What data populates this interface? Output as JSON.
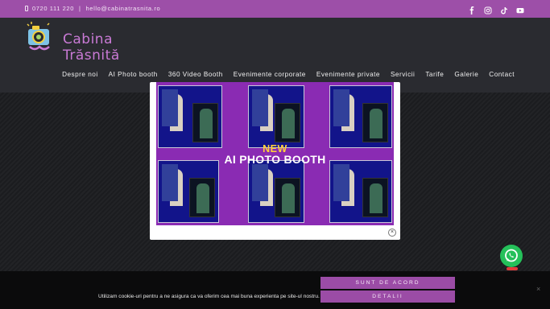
{
  "topbar": {
    "phone": "0720 111 220",
    "separator": "|",
    "email": "hello@cabinatrasnita.ro",
    "socials": [
      "facebook-icon",
      "instagram-icon",
      "tiktok-icon",
      "youtube-icon"
    ]
  },
  "header": {
    "logo_text": "Cabina Trăsnită",
    "nav": [
      "Despre noi",
      "AI Photo booth",
      "360 Video Booth",
      "Evenimente corporate",
      "Evenimente private",
      "Servicii",
      "Tarife",
      "Galerie",
      "Contact"
    ]
  },
  "modal": {
    "banner_new": "NEW",
    "banner_main": "AI PHOTO BOOTH",
    "close": "×"
  },
  "cookie": {
    "text": "Utilizam cookie-uri pentru a ne asigura ca va oferim cea mai buna experienta pe site-ul nostru.",
    "accept": "SUNT DE ACORD",
    "details": "DETALII",
    "close": "×"
  },
  "colors": {
    "brand_purple": "#9d4fa8",
    "header_bg": "#2a2b30",
    "whatsapp_green": "#25c05a"
  }
}
